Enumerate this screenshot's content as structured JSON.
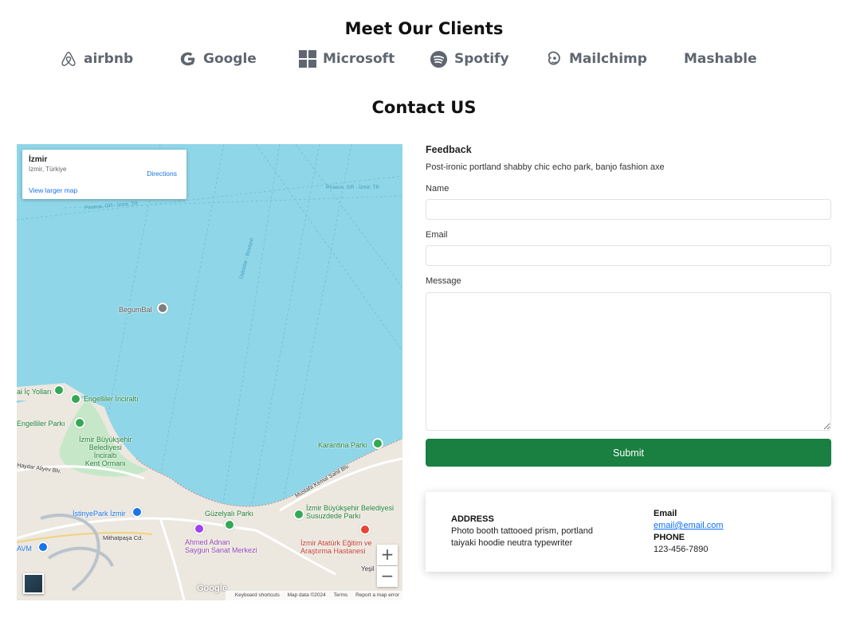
{
  "clients": {
    "title": "Meet Our Clients",
    "items": [
      {
        "name": "airbnb",
        "icon": "airbnb-icon"
      },
      {
        "name": "Google",
        "icon": "google-icon"
      },
      {
        "name": "Microsoft",
        "icon": "microsoft-icon"
      },
      {
        "name": "Spotify",
        "icon": "spotify-icon"
      },
      {
        "name": "Mailchimp",
        "icon": "mailchimp-icon"
      },
      {
        "name": "Mashable",
        "icon": ""
      }
    ]
  },
  "contact": {
    "title": "Contact US"
  },
  "map": {
    "card": {
      "place": "İzmir",
      "sub": "İzmir, Türkiye",
      "directions": "Directions",
      "larger": "View larger map"
    },
    "labels": {
      "begumbal": "BegumBal",
      "engelliler_inciralti": "Engelliler İnciraltı",
      "ic_yollari": "ai İç Yolları",
      "engelliler_parki": "Engelliler Parkı",
      "kent_ormani": "İzmir Büyükşehir\nBelediyesi\nİnciraltı\nKent Ormanı",
      "karantina": "Karantina Parkı",
      "istinyepark": "İstinyePark İzmir",
      "guzelyali": "Güzelyalı Parkı",
      "ahmed_adnan": "Ahmed Adnan\nSaygun Sanat Merkezi",
      "susuzdede": "İzmir Büyükşehir Belediyesi\nSusuzdede Parkı",
      "ataturk": "İzmir Atatürk Eğitim ve\nAraştırma Hastanesi",
      "mithatpasa": "Mithatpaşa Cd.",
      "avm": "AVM",
      "piraeus_1": "Piraeus, GR - İzmir, TR",
      "piraeus_2": "Piraeus, GR - İzmir, TR",
      "uskudar": "Üsküdar - Bostanlı",
      "mustafa": "Mustafa Kemal Sahil Blv.",
      "haydar": "Haydar Aliyev Blv.",
      "yesil": "Yeşil"
    },
    "zoom_in": "+",
    "zoom_out": "−",
    "google": "Google",
    "attribution": {
      "shortcuts": "Keyboard shortcuts",
      "data": "Map data ©2024",
      "terms": "Terms",
      "report": "Report a map error"
    }
  },
  "form": {
    "title": "Feedback",
    "description": "Post-ironic portland shabby chic echo park, banjo fashion axe",
    "name_label": "Name",
    "name_value": "",
    "email_label": "Email",
    "email_value": "",
    "message_label": "Message",
    "message_value": "",
    "submit": "Submit"
  },
  "info": {
    "address_heading": "ADDRESS",
    "address": "Photo booth tattooed prism, portland taiyaki hoodie neutra typewriter",
    "email_heading": "Email",
    "email": "email@email.com",
    "phone_heading": "PHONE",
    "phone": "123-456-7890"
  },
  "colors": {
    "submit": "#198041",
    "water": "#8fd6e8",
    "link": "#0d6efd",
    "client_text": "#5f6670"
  }
}
